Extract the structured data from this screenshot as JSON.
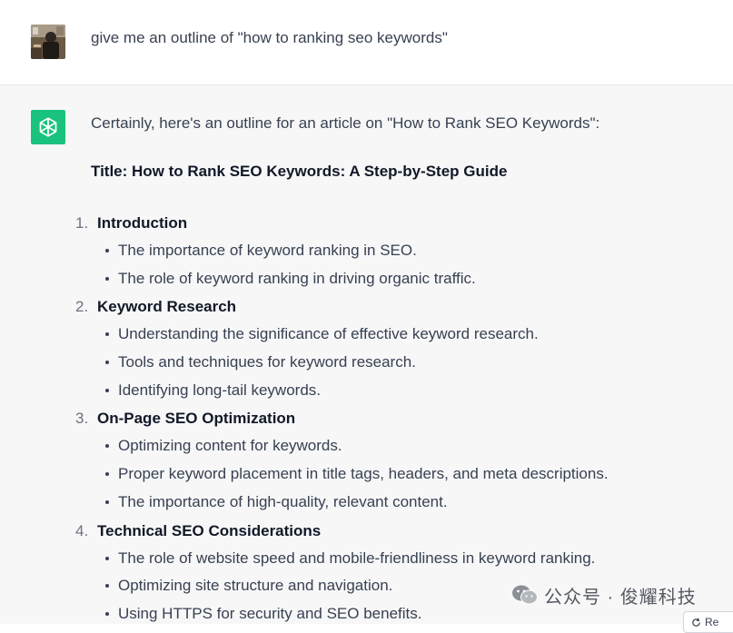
{
  "user_message": {
    "text": "give me an outline of \"how to ranking seo keywords\"",
    "avatar_icon": "user-avatar-photo"
  },
  "assistant_message": {
    "avatar_icon": "openai-logo-icon",
    "intro": "Certainly, here's an outline for an article on \"How to Rank SEO Keywords\":",
    "title": "Title: How to Rank SEO Keywords: A Step-by-Step Guide",
    "sections": [
      {
        "num": "1.",
        "title": "Introduction",
        "bullets": [
          "The importance of keyword ranking in SEO.",
          "The role of keyword ranking in driving organic traffic."
        ]
      },
      {
        "num": "2.",
        "title": "Keyword Research",
        "bullets": [
          "Understanding the significance of effective keyword research.",
          "Tools and techniques for keyword research.",
          "Identifying long-tail keywords."
        ]
      },
      {
        "num": "3.",
        "title": "On-Page SEO Optimization",
        "bullets": [
          "Optimizing content for keywords.",
          "Proper keyword placement in title tags, headers, and meta descriptions.",
          "The importance of high-quality, relevant content."
        ]
      },
      {
        "num": "4.",
        "title": "Technical SEO Considerations",
        "bullets": [
          "The role of website speed and mobile-friendliness in keyword ranking.",
          "Optimizing site structure and navigation.",
          "Using HTTPS for security and SEO benefits."
        ]
      }
    ]
  },
  "watermark": {
    "text": "公众号 · 俊耀科技",
    "icon": "wechat-icon"
  },
  "regenerate_button": {
    "label": "Re",
    "icon": "refresh-icon"
  },
  "colors": {
    "assistant_bg": "#f7f7f8",
    "user_bg": "#ffffff",
    "openai_green": "#19c37d"
  }
}
